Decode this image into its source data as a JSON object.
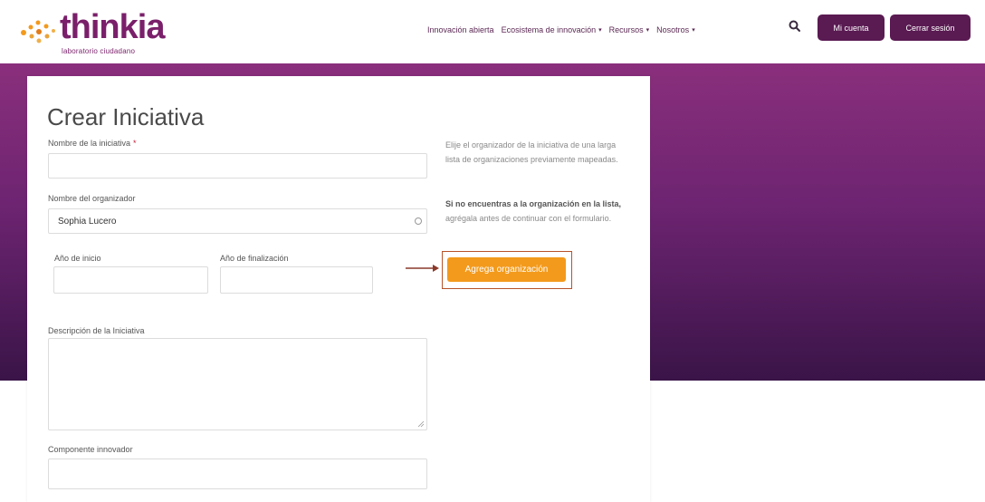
{
  "header": {
    "logo": {
      "wordmark_first": "t",
      "wordmark_rest": "hinkia",
      "subtitle": "laboratorio ciudadano"
    },
    "nav": [
      {
        "label": "Innovación abierta",
        "has_caret": false
      },
      {
        "label": "Ecosistema de innovación",
        "has_caret": true
      },
      {
        "label": "Recursos",
        "has_caret": true
      },
      {
        "label": "Nosotros",
        "has_caret": true
      }
    ],
    "search_icon": "search-icon",
    "account_button": "Mi cuenta",
    "logout_button": "Cerrar sesión"
  },
  "form": {
    "title": "Crear Iniciativa",
    "name_label": "Nombre de la iniciativa",
    "required_mark": "*",
    "name_value": "",
    "organizer_label": "Nombre del organizador",
    "organizer_value": "Sophia Lucero",
    "start_year_label": "Año de inicio",
    "end_year_label": "Año de finalización",
    "description_label": "Descripción de la Iniciativa",
    "component_label": "Componente innovador"
  },
  "help": {
    "paragraph1": "Elije el organizador de la iniciativa de una larga lista de organizaciones previamente mapeadas.",
    "paragraph2_bold": "Si no encuentras a la organización en la lista,",
    "paragraph2_rest": " agrégala antes de continuar con el formulario.",
    "add_org_button": "Agrega organización"
  },
  "colors": {
    "brand_purple": "#5a1a52",
    "accent_orange": "#f39a1c",
    "highlight_frame": "#b7532a"
  }
}
